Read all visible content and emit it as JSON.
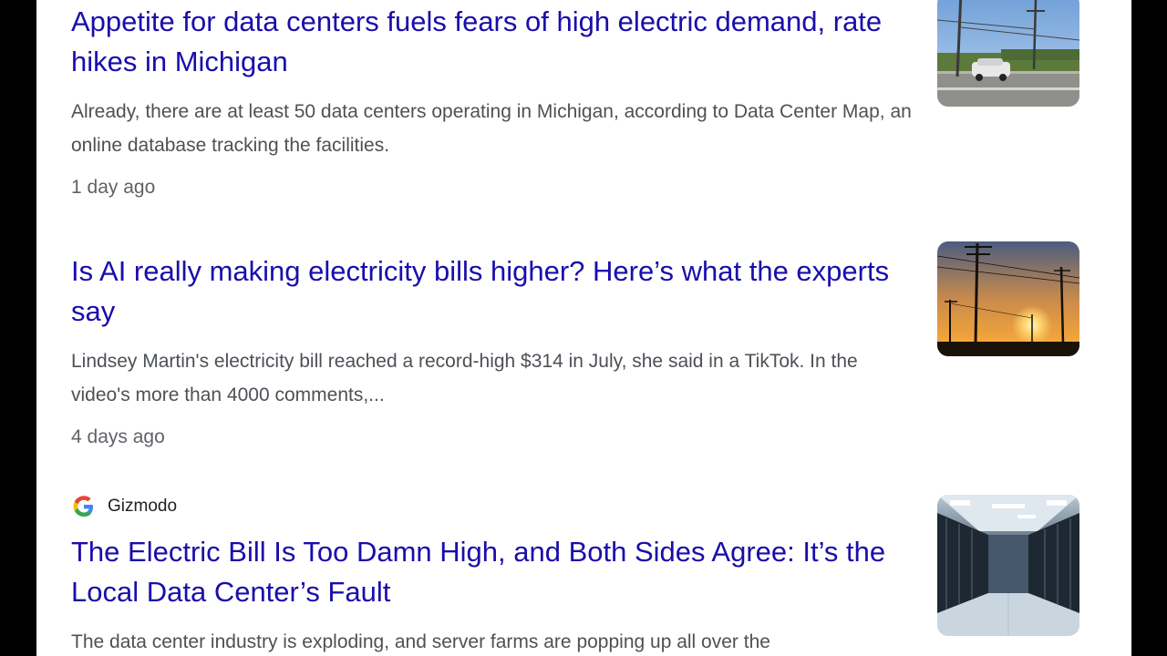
{
  "results": [
    {
      "title": "Appetite for data centers fuels fears of high electric demand, rate hikes in Michigan",
      "snippet": "Already, there are at least 50 data centers operating in Michigan, according to Data Center Map, an online database tracking the facilities.",
      "time": "1 day ago",
      "thumbnail": "roadside-utility-poles-car"
    },
    {
      "title": "Is AI really making electricity bills higher? Here’s what the experts say",
      "snippet": "Lindsey Martin's electricity bill reached a record-high $314 in July, she said in a TikTok. In the video's more than 4000 comments,...",
      "time": "4 days ago",
      "thumbnail": "power-lines-sunset"
    },
    {
      "source": "Gizmodo",
      "source_icon": "gizmodo-g-logo",
      "title": "The Electric Bill Is Too Damn High, and Both Sides Agree: It’s the Local Data Center’s Fault",
      "snippet": "The data center industry is exploding, and server farms are popping up all over the",
      "thumbnail": "server-room-aisle"
    }
  ],
  "colors": {
    "link": "#1a0dab",
    "snippet": "#4d5156",
    "time": "#5f6368",
    "background": "#ffffff",
    "frame": "#000000"
  }
}
